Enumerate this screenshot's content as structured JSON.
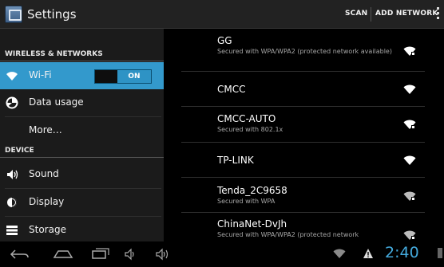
{
  "actionbar": {
    "title": "Settings",
    "scan_label": "SCAN",
    "add_network_label": "ADD NETWORK"
  },
  "sidebar": {
    "section_wireless": "WIRELESS & NETWORKS",
    "section_device": "DEVICE",
    "items": [
      {
        "label": "Wi-Fi",
        "icon": "wifi-icon",
        "selected": true,
        "toggle": "ON"
      },
      {
        "label": "Data usage",
        "icon": "data-usage-icon"
      },
      {
        "label": "More…"
      },
      {
        "label": "Sound",
        "icon": "sound-icon"
      },
      {
        "label": "Display",
        "icon": "display-icon"
      },
      {
        "label": "Storage",
        "icon": "storage-icon"
      }
    ]
  },
  "networks": [
    {
      "ssid": "GG",
      "status": "Secured with WPA/WPA2 (protected network available)",
      "locked": true
    },
    {
      "ssid": "CMCC",
      "status": "",
      "locked": false
    },
    {
      "ssid": "CMCC-AUTO",
      "status": "Secured with 802.1x",
      "locked": true
    },
    {
      "ssid": "TP-LINK",
      "status": "",
      "locked": false
    },
    {
      "ssid": "Tenda_2C9658",
      "status": "Secured with WPA",
      "locked": true
    },
    {
      "ssid": "ChinaNet-DvJh",
      "status": "Secured with WPA/WPA2 (protected network",
      "locked": true
    }
  ],
  "statusbar": {
    "time": "2:40"
  },
  "colors": {
    "accent": "#3399cc",
    "clock": "#44aadd"
  }
}
